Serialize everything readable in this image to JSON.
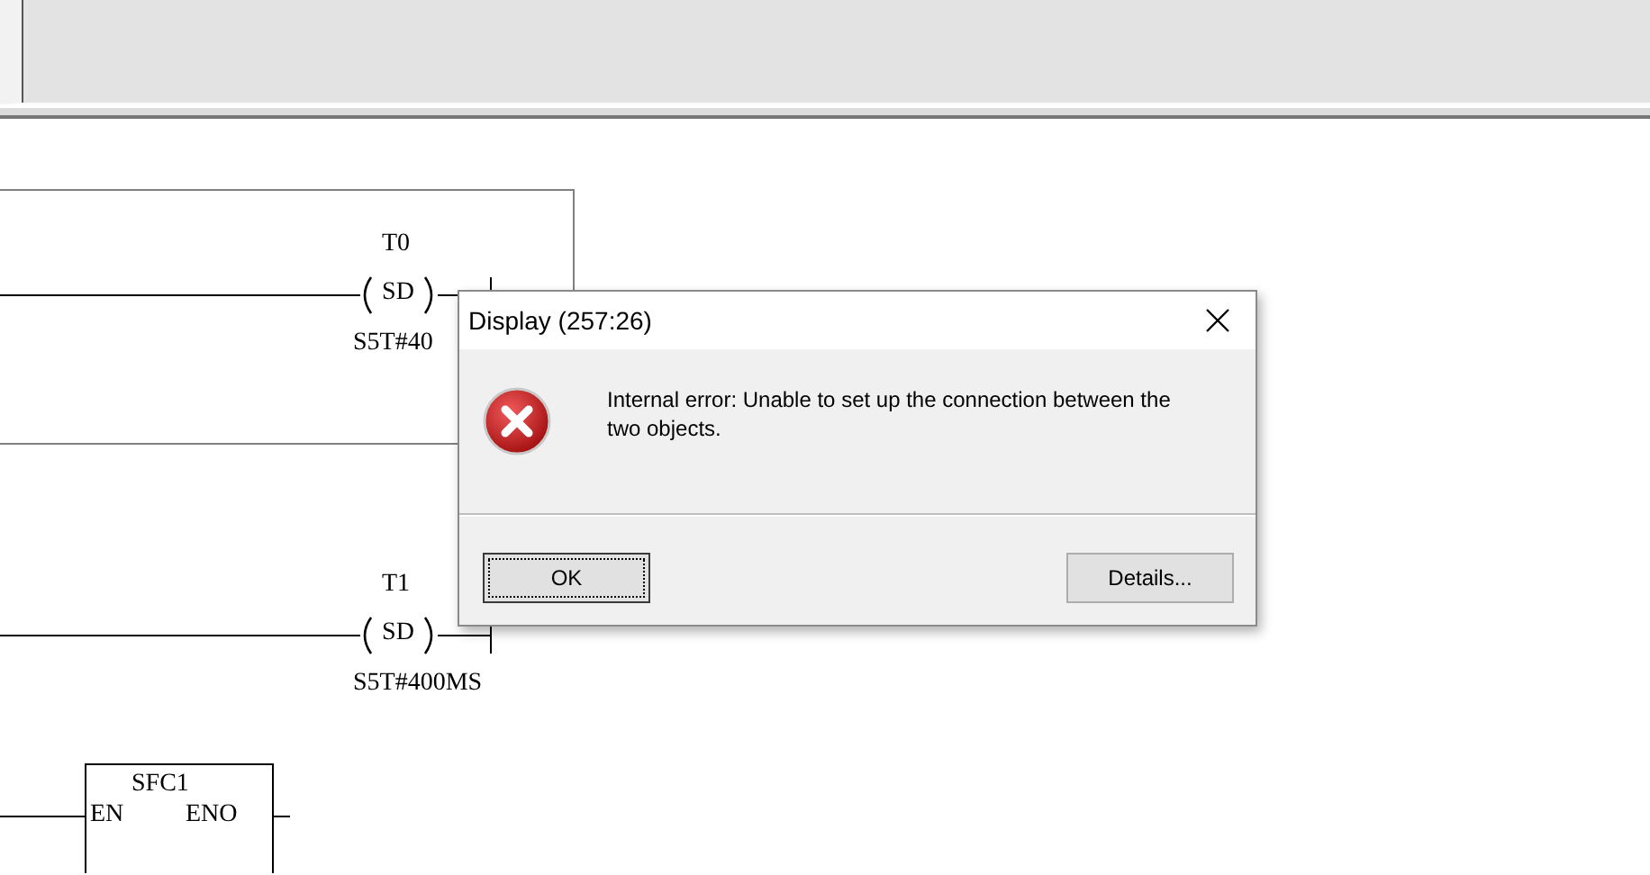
{
  "ladder": {
    "networks": [
      {
        "kind": "coil",
        "selected": true,
        "operand": "T0",
        "instruction": "SD",
        "value": "S5T#40"
      },
      {
        "kind": "coil",
        "selected": false,
        "operand": "T1",
        "instruction": "SD",
        "value": "S5T#400MS"
      },
      {
        "kind": "box",
        "selected": false,
        "name": "SFC1",
        "input": "EN",
        "output": "ENO"
      }
    ]
  },
  "dialog": {
    "title": "Display (257:26)",
    "message": "Internal error: Unable to set up the connection between the two objects.",
    "buttons": [
      {
        "label": "OK",
        "focused": true
      },
      {
        "label": "Details...",
        "focused": false
      }
    ]
  }
}
